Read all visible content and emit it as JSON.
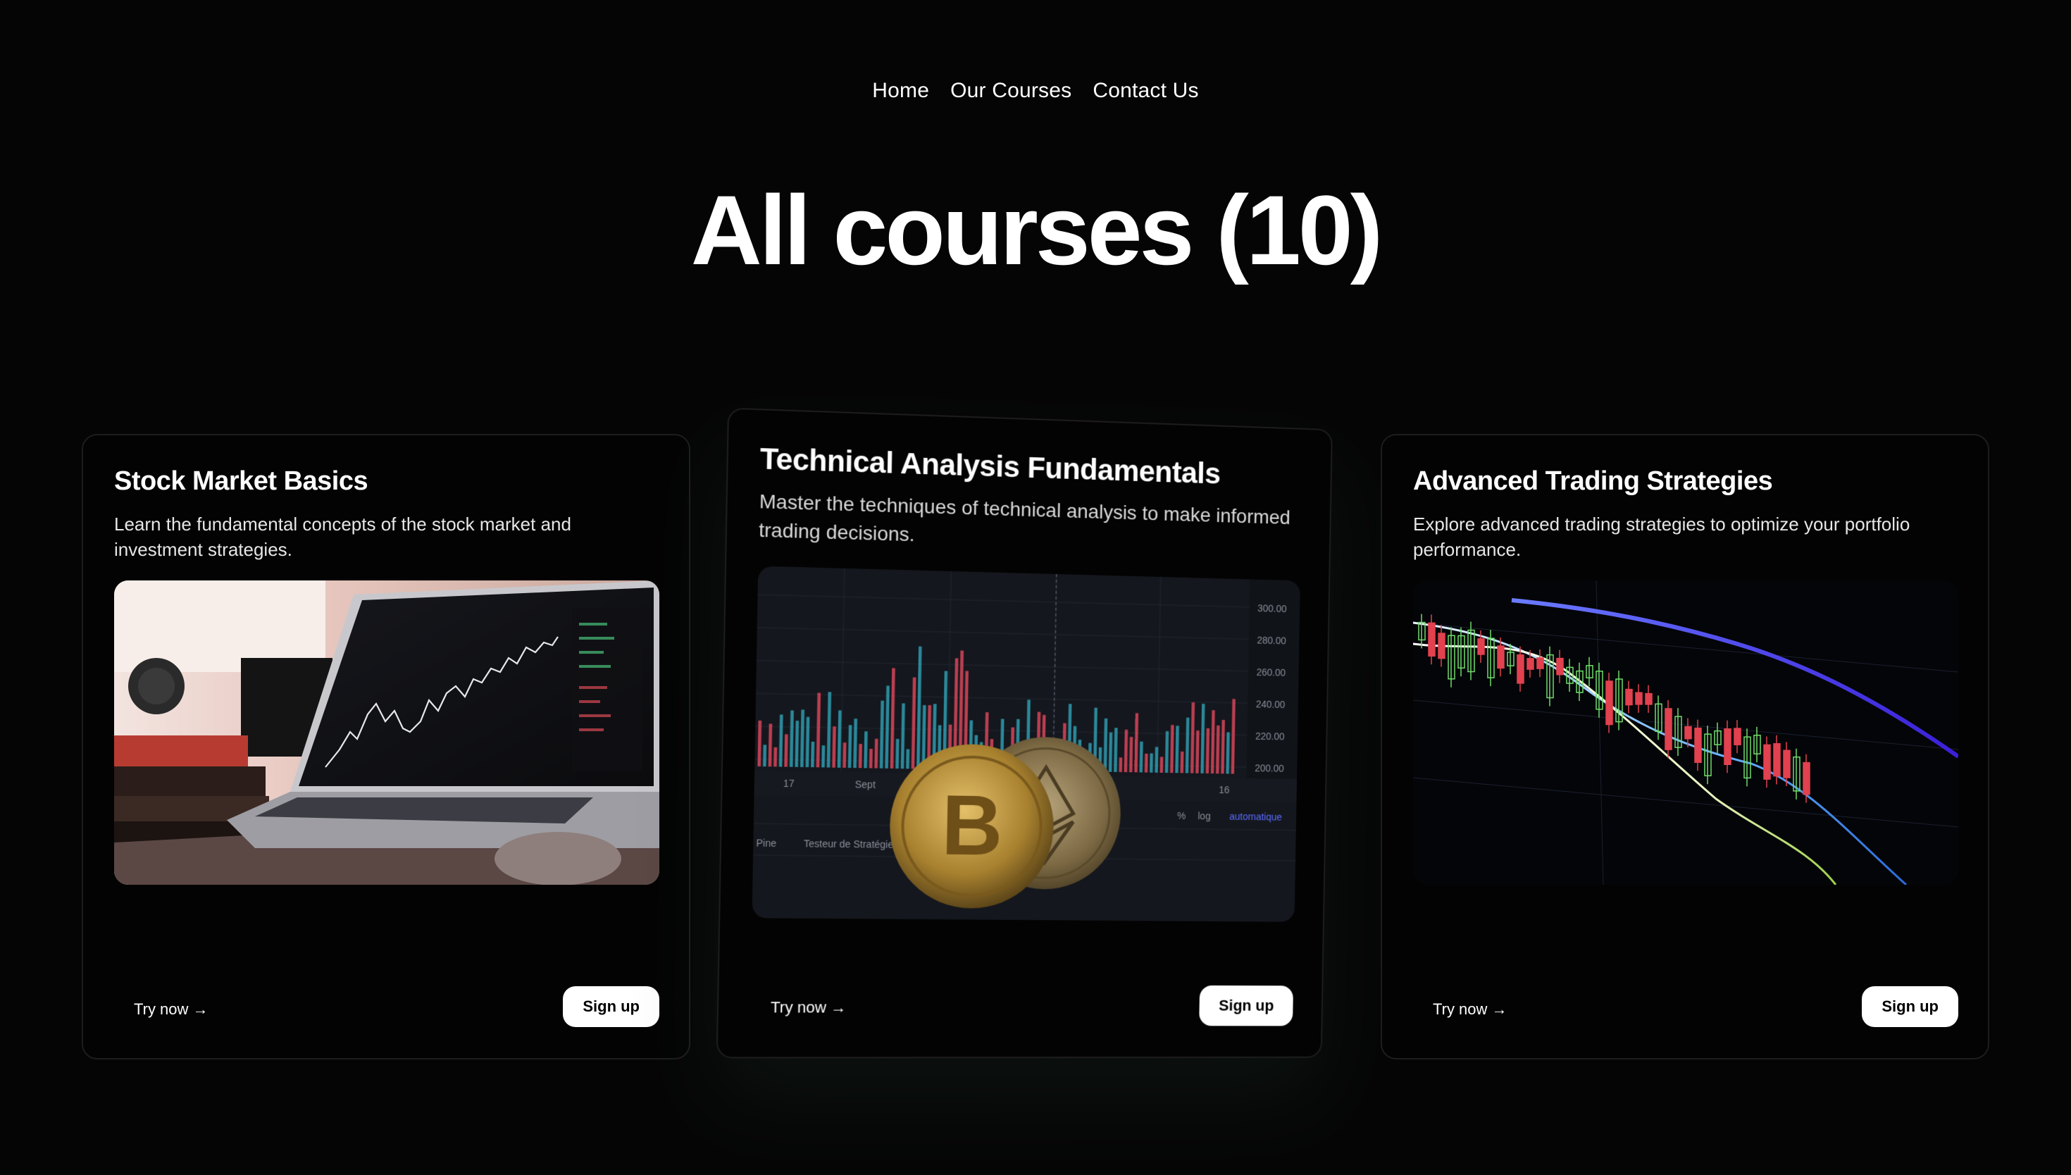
{
  "nav": {
    "items": [
      "Home",
      "Our Courses",
      "Contact Us"
    ]
  },
  "page": {
    "title": "All courses (10)"
  },
  "cards": [
    {
      "title": "Stock Market Basics",
      "description": "Learn the fundamental concepts of the stock market and investment strategies.",
      "try_label": "Try now →",
      "signup_label": "Sign up",
      "image": "laptop-trading-chart-image"
    },
    {
      "title": "Technical Analysis Fundamentals",
      "description": "Master the techniques of technical analysis to make informed trading decisions.",
      "try_label": "Try now →",
      "signup_label": "Sign up",
      "image": "crypto-coins-chart-image",
      "chart_axis_labels": [
        "300.00",
        "280.00",
        "260.00",
        "240.00",
        "220.00",
        "200.00"
      ],
      "chart_time_labels": [
        "17",
        "Sept",
        "16"
      ],
      "chart_toolbar": [
        "%",
        "log",
        "automatique"
      ],
      "chart_panel": [
        "Pine",
        "Testeur de Stratégie"
      ]
    },
    {
      "title": "Advanced Trading Strategies",
      "description": "Explore advanced trading strategies to optimize your portfolio performance.",
      "try_label": "Try now →",
      "signup_label": "Sign up",
      "image": "candlestick-chart-image"
    }
  ],
  "colors": {
    "background": "#050505",
    "card_border": "#1d1d1d",
    "accent_up": "#3ecf6a",
    "accent_down": "#e34050",
    "accent_line": "#4a4cff"
  }
}
